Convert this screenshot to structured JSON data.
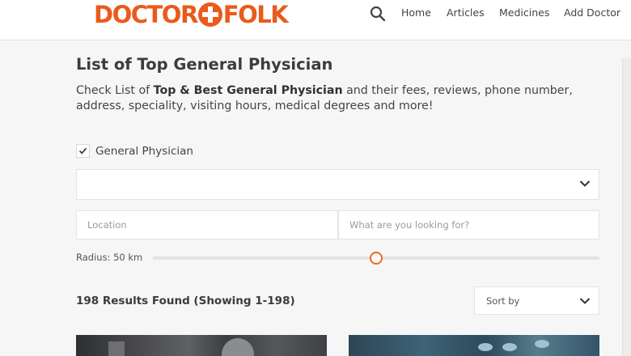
{
  "header": {
    "logo_text": "DOCTOR+FOLK",
    "logo_left": "DOCTOR",
    "logo_right": "FOLK",
    "search_icon": "search-icon",
    "nav": [
      "Home",
      "Articles",
      "Medicines",
      "Add Doctor"
    ]
  },
  "main": {
    "title": "List of Top General Physician",
    "desc_prefix": "Check List of ",
    "desc_bold": "Top & Best General Physician",
    "desc_suffix": " and their fees, reviews, phone number, address, speciality, visiting hours, medical degrees and more!"
  },
  "filters": {
    "category_label": "General Physician",
    "category_checked": true,
    "dropdown_value": "",
    "location_placeholder": "Location",
    "query_placeholder": "What are you looking for?",
    "radius_label": "Radius: 50 km",
    "radius_level": 0.5
  },
  "results": {
    "summary": "198 Results Found (Showing 1-198)",
    "sort_label": "Sort by"
  },
  "colors": {
    "brand": "#ea5a1c",
    "slider_thumb": "#ea6a20"
  }
}
